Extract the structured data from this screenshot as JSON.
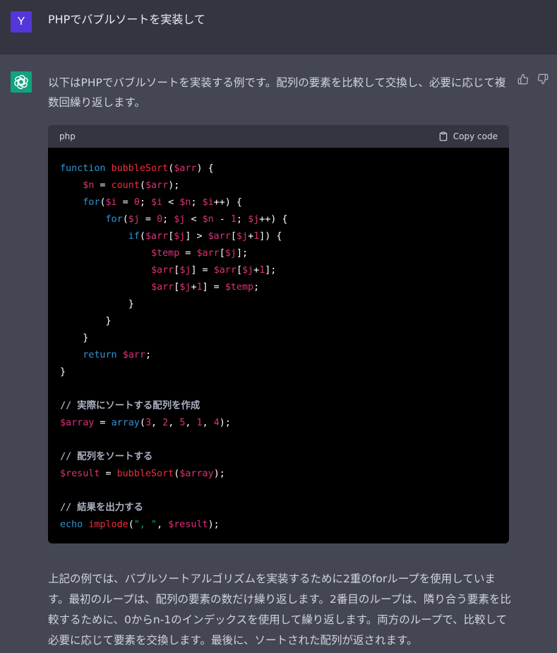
{
  "user": {
    "avatar_letter": "Y",
    "message": "PHPでバブルソートを実装して"
  },
  "assistant": {
    "intro": "以下はPHPでバブルソートを実装する例です。配列の要素を比較して交換し、必要に応じて複数回繰り返します。",
    "code": {
      "language": "php",
      "copy_label": "Copy code"
    },
    "outro": "上記の例では、バブルソートアルゴリズムを実装するために2重のforループを使用しています。最初のループは、配列の要素の数だけ繰り返します。2番目のループは、隣り合う要素を比較するために、0からn-1のインデックスを使用して繰り返します。両方のループで、比較して必要に応じて要素を交換します。最後に、ソートされた配列が返されます。"
  },
  "colors": {
    "user_bg": "#343541",
    "assistant_bg": "#444654",
    "user_avatar": "#5436da",
    "gpt_avatar": "#10a37f"
  },
  "icons": [
    "openai-logo-icon",
    "thumbs-up-icon",
    "thumbs-down-icon",
    "clipboard-icon"
  ]
}
